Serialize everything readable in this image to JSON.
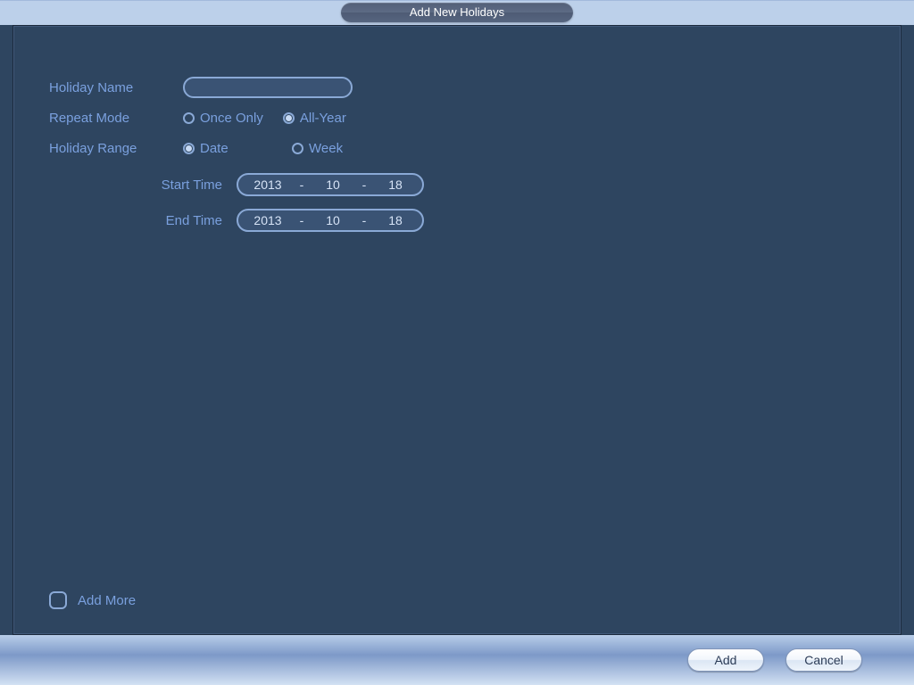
{
  "dialog": {
    "title": "Add New Holidays"
  },
  "form": {
    "holidayName": {
      "label": "Holiday Name",
      "value": ""
    },
    "repeatMode": {
      "label": "Repeat Mode",
      "options": {
        "once": "Once Only",
        "all": "All-Year"
      },
      "selected": "all"
    },
    "holidayRange": {
      "label": "Holiday Range",
      "options": {
        "date": "Date",
        "week": "Week"
      },
      "selected": "date"
    },
    "startTime": {
      "label": "Start Time",
      "year": "2013",
      "month": "10",
      "day": "18"
    },
    "endTime": {
      "label": "End Time",
      "year": "2013",
      "month": "10",
      "day": "18"
    },
    "addMore": {
      "label": "Add More",
      "checked": false
    }
  },
  "buttons": {
    "add": "Add",
    "cancel": "Cancel"
  },
  "glyph": {
    "dash": "-"
  }
}
